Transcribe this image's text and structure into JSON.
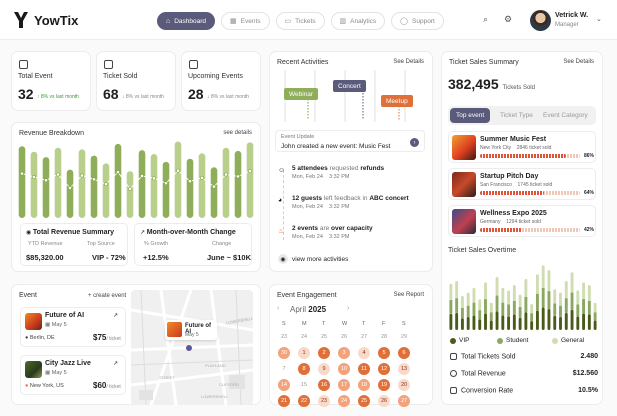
{
  "app": {
    "name": "YowTix"
  },
  "nav": [
    {
      "label": "Dashboard",
      "icon": "home-icon"
    },
    {
      "label": "Events",
      "icon": "calendar-icon"
    },
    {
      "label": "Tickets",
      "icon": "ticket-icon"
    },
    {
      "label": "Analytics",
      "icon": "chart-icon"
    },
    {
      "label": "Support",
      "icon": "chat-icon"
    }
  ],
  "user": {
    "name": "Vetrick W.",
    "role": "Manager"
  },
  "stats": [
    {
      "label": "Total Event",
      "value": "32",
      "delta": "8% vs last month",
      "dir": "up"
    },
    {
      "label": "Ticket Sold",
      "value": "68",
      "delta": "8% vs last month",
      "dir": "down"
    },
    {
      "label": "Upcoming Events",
      "value": "28",
      "delta": "8% vs last month",
      "dir": "down"
    }
  ],
  "revenue": {
    "title": "Revenue Breakdown",
    "link": "see details",
    "bars": [
      0.92,
      0.85,
      0.78,
      0.9,
      0.62,
      0.88,
      0.8,
      0.7,
      0.95,
      0.6,
      0.87,
      0.82,
      0.72,
      0.98,
      0.76,
      0.83,
      0.65,
      0.9,
      0.86,
      0.97
    ],
    "summary1": {
      "title": "Total Revenue Summary",
      "l1": "YTD Revenue",
      "v1": "$85,320.00",
      "l2": "Top Source",
      "v2": "VIP - 72%"
    },
    "summary2": {
      "title": "Month-over-Month Change",
      "l1": "% Growth",
      "v1": "+12.5%",
      "l2": "Change",
      "v2": "June ~ $10K"
    }
  },
  "events": {
    "title": "Event",
    "link": "+ create event",
    "items": [
      {
        "name": "Future of AI",
        "date": "May 5",
        "loc": "Berlin, DE",
        "price": "$75",
        "unit": "/ ticket"
      },
      {
        "name": "City Jazz Live",
        "date": "May 5",
        "loc": "New York, US",
        "price": "$60",
        "unit": "/ ticket"
      }
    ],
    "map": {
      "pin_label": "Future of AI",
      "pin_date": "May 5",
      "streets": [
        "LOWERSHELL",
        "STREET",
        "PLAYLAND",
        "CLIFFORD",
        "LOWERSHELL"
      ]
    }
  },
  "activities": {
    "title": "Recent Activities",
    "link": "See Details",
    "tags": [
      "Webinar",
      "Concert",
      "Meetup"
    ],
    "update_label": "Event Update",
    "update_text": "John created a new event: Music Fest",
    "items": [
      {
        "pre": "5 attendees",
        "mid": " requested ",
        "post": "refunds",
        "date": "Mon, Feb 24",
        "time": "3:32 PM"
      },
      {
        "pre": "12 guests",
        "mid": " left feedback in ",
        "post": "ABC concert",
        "date": "Mon, Feb 24",
        "time": "3:32 PM"
      },
      {
        "pre": "2 events",
        "mid": " are ",
        "post": "over capacity",
        "date": "Mon, Feb 24",
        "time": "3:32 PM"
      }
    ],
    "more": "view more activities"
  },
  "engagement": {
    "title": "Event Engagement",
    "link": "See Report",
    "month": "April",
    "year": "2025",
    "dows": [
      "S",
      "M",
      "T",
      "W",
      "T",
      "F",
      "S"
    ],
    "rows": [
      [
        23,
        24,
        25,
        26,
        27,
        28,
        29
      ],
      [
        30,
        1,
        2,
        3,
        4,
        5,
        6
      ],
      [
        7,
        8,
        9,
        10,
        11,
        12,
        13
      ],
      [
        14,
        15,
        16,
        17,
        18,
        19,
        20
      ],
      [
        21,
        22,
        23,
        24,
        25,
        26,
        27
      ]
    ],
    "heat": [
      [
        0,
        0,
        0,
        0,
        0,
        0,
        0
      ],
      [
        2,
        1,
        3,
        2,
        1,
        3,
        3
      ],
      [
        0,
        3,
        1,
        2,
        3,
        3,
        1
      ],
      [
        2,
        0,
        3,
        2,
        2,
        3,
        1
      ],
      [
        3,
        3,
        1,
        2,
        3,
        1,
        2
      ]
    ]
  },
  "sales": {
    "title": "Ticket Sales Summary",
    "link": "See Details",
    "total": "382,495",
    "total_label": "Tickets Sold",
    "tabs": [
      "Top event",
      "Ticket Type",
      "Event Category"
    ],
    "top": [
      {
        "name": "Summer Music Fest",
        "loc": "New York City",
        "sold": "2846 ticket sold",
        "pct": 0.86,
        "pct_label": "86%"
      },
      {
        "name": "Startup Pitch Day",
        "loc": "San Francisco",
        "sold": "1745 ticket sold",
        "pct": 0.64,
        "pct_label": "64%"
      },
      {
        "name": "Wellness Expo 2025",
        "loc": "Germany",
        "sold": "1294 ticket sold",
        "pct": 0.42,
        "pct_label": "42%"
      }
    ]
  },
  "overtime": {
    "title": "Ticket Sales Overtime",
    "bars": [
      0.68,
      0.72,
      0.5,
      0.55,
      0.62,
      0.45,
      0.7,
      0.4,
      0.78,
      0.62,
      0.58,
      0.66,
      0.52,
      0.75,
      0.38,
      0.82,
      0.95,
      0.88,
      0.6,
      0.55,
      0.72,
      0.85,
      0.58,
      0.7,
      0.66,
      0.4
    ],
    "legend": [
      {
        "label": "VIP",
        "color": "#4a5a1a"
      },
      {
        "label": "Student",
        "color": "#8aa860"
      },
      {
        "label": "General",
        "color": "#cfddb0"
      }
    ],
    "metrics": [
      {
        "label": "Total Tickets Sold",
        "value": "2.480"
      },
      {
        "label": "Total Revenue",
        "value": "$12.560"
      },
      {
        "label": "Conversion Rate",
        "value": "10.5%"
      }
    ]
  },
  "colors": {
    "accent": "#5a5a7a",
    "green": "#8fae5a",
    "orange": "#e0703a"
  }
}
